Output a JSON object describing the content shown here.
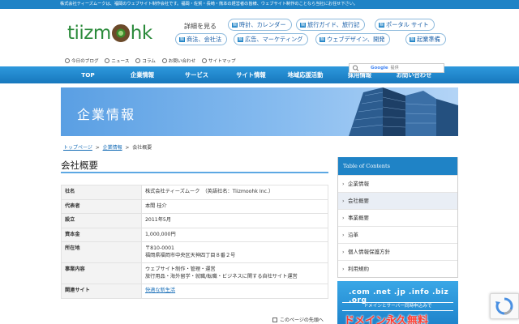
{
  "topbar": {
    "text": "株式会社ティーズムークは、福岡のウェブサイト制作会社です。福岡・佐賀・長崎・熊本の経営者の皆様、ウェブサイト制作のことなら当社にお任せ下さい。"
  },
  "logo": {
    "text_left": "tiizm",
    "text_right": "hk"
  },
  "header": {
    "detail_label": "詳細を見る",
    "categories": [
      {
        "tag": "鯛",
        "label": "時計、カレンダー"
      },
      {
        "tag": "鯛",
        "label": "旅行ガイド、旅行記"
      },
      {
        "tag": "鯛",
        "label": "ポータル サイト"
      },
      {
        "tag": "鯛",
        "label": "商法、会社法"
      },
      {
        "tag": "鯛",
        "label": "広告、マーケティング"
      },
      {
        "tag": "鯛",
        "label": "ウェブデザイン、開発"
      },
      {
        "tag": "鯛",
        "label": "起業準備"
      }
    ]
  },
  "subnav": [
    "今日のブログ",
    "ニュース",
    "コラム",
    "お問い合わせ",
    "サイトマップ"
  ],
  "search": {
    "brand": "Google",
    "suffix": "提供"
  },
  "mainnav": [
    "TOP",
    "企業情報",
    "サービス",
    "サイト情報",
    "地域応援活動",
    "採用情報",
    "お問い合わせ"
  ],
  "banner": {
    "title": "企業情報"
  },
  "breadcrumb": {
    "home": "トップページ",
    "sep": ">",
    "parent": "企業情報",
    "current": "会社概要"
  },
  "page_title": "会社概要",
  "company_table": [
    {
      "key": "社名",
      "value": "株式会社ティーズムーク　（英語社名：Tiizmoohk Inc.）"
    },
    {
      "key": "代表者",
      "value": "本間 桂介"
    },
    {
      "key": "設立",
      "value": "2011年5月"
    },
    {
      "key": "資本金",
      "value": "1,000,000円"
    },
    {
      "key": "所在地",
      "value": "〒810-0001",
      "value2": "福岡県福岡市中央区天神四丁目８番２号"
    },
    {
      "key": "事業内容",
      "value": "ウェブサイト制作・管理・運営",
      "value2": "旅行用品・海外留学・就職/転職・ビジネスに関する自社サイト運営"
    },
    {
      "key": "関連サイト",
      "value": "快適な新生活"
    }
  ],
  "footer_check": "このページの先頭へ",
  "toc": {
    "title": "Table of Contents",
    "items": [
      "企業情報",
      "会社概要",
      "事業概要",
      "沿革",
      "個人情報保護方針",
      "利用規約"
    ],
    "active_index": 1
  },
  "ad": {
    "tlds": ".com .net .jp .info .biz .org",
    "line2": "ドメインとサーバー同時申込みで",
    "line3": "ドメイン永久無料"
  },
  "colors": {
    "brand_blue": "#1f83c6",
    "logo_green": "#2a8a3a",
    "link": "#1a6fb8"
  }
}
